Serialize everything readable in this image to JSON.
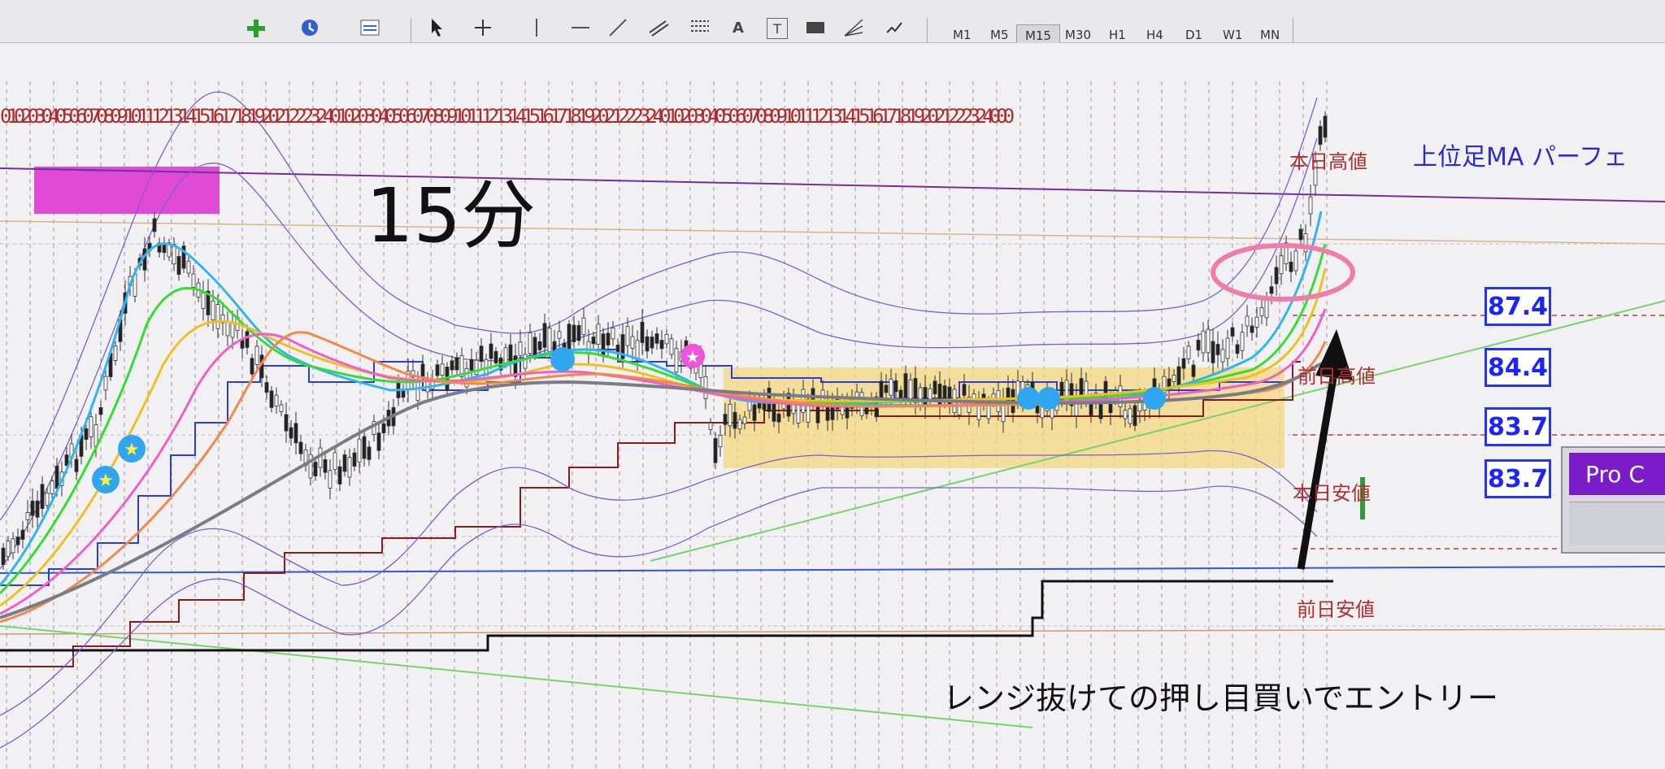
{
  "toolbar": {
    "timeframes": [
      "M1",
      "M5",
      "M15",
      "M30",
      "H1",
      "H4",
      "D1",
      "W1",
      "MN"
    ],
    "active_timeframe": "M15",
    "tool_glyphs": [
      "↖",
      "+",
      "|",
      "—",
      "/",
      "A",
      "T"
    ]
  },
  "chart": {
    "title_overlay": "15分",
    "indicator_title": "上位足MA パーフェ",
    "date_strip": "010203040506070809101112131415161718192021222324010203040506070809101112131415161718192021222324010203040506070809101112131415161718192021222324",
    "date_strip_end": "000",
    "levels": {
      "today_high": "本日高値",
      "prev_high": "前日高値",
      "today_low": "本日安値",
      "prev_low": "前日安値"
    },
    "price_boxes": [
      "87.4",
      "84.4",
      "83.7",
      "83.7"
    ],
    "note": "レンジ抜けての押し目買いでエントリー",
    "pro_button_label": "Pro C"
  },
  "colors": {
    "range_box": "#f5d77a",
    "magenta_box": "#e04ad4",
    "ma_gray": "#7a7d86",
    "price_box_border": "#2233ff",
    "ellipse": "#f07cab",
    "arrow": "#111111"
  },
  "icons": {
    "cursor": "cursor-icon",
    "crosshair": "crosshair-icon",
    "plus": "plus-icon",
    "clock": "clock-icon"
  }
}
